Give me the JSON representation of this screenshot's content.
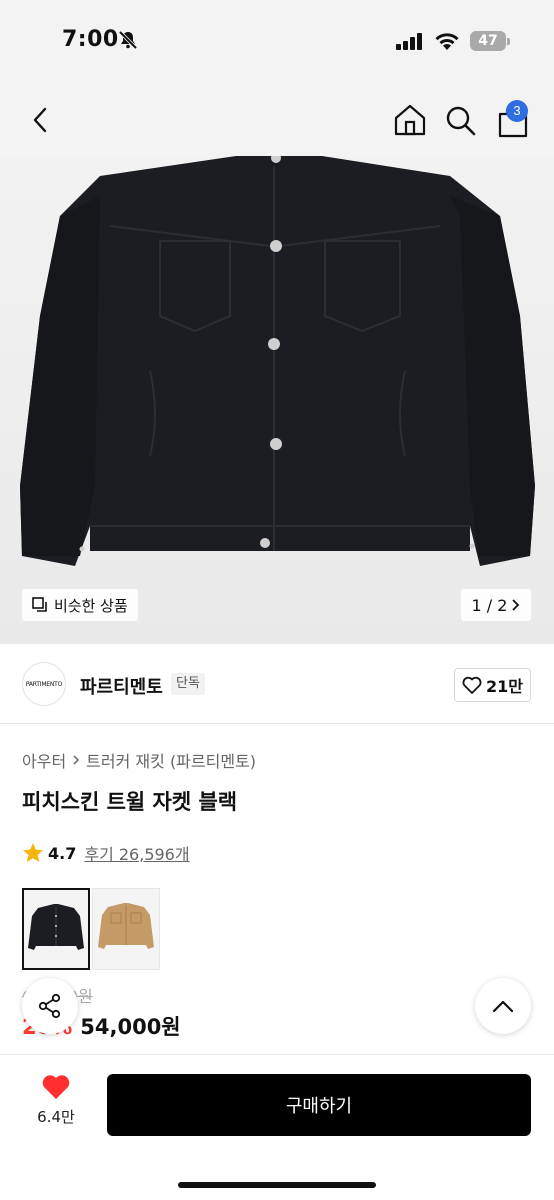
{
  "status_bar": {
    "time": "7:00",
    "battery": "47"
  },
  "nav": {
    "cart_count": "3"
  },
  "gallery": {
    "similar_label": "비슷한 상품",
    "page_counter": "1 / 2"
  },
  "brand": {
    "logo_text": "PARTIMENTO",
    "name": "파르티멘토",
    "badge": "단독",
    "likes": "21만"
  },
  "breadcrumb": [
    "아우터",
    "트러커 재킷 (파르티멘토)"
  ],
  "product": {
    "title": "피치스킨 트윌 자켓 블랙",
    "rating": "4.7",
    "reviews": "후기 26,596개",
    "original_price": "69,000원",
    "discount_rate": "20%",
    "sale_price": "54,000원"
  },
  "color_options": [
    {
      "name": "black-jacket",
      "color": "#1b1d22"
    },
    {
      "name": "tan-jacket",
      "color": "#c49a67"
    }
  ],
  "bottom_bar": {
    "wish_count": "6.4만",
    "buy_label": "구매하기"
  },
  "colors": {
    "accent_red": "#ff3b30",
    "badge_blue": "#2f6de1",
    "star": "#f5b50a"
  }
}
